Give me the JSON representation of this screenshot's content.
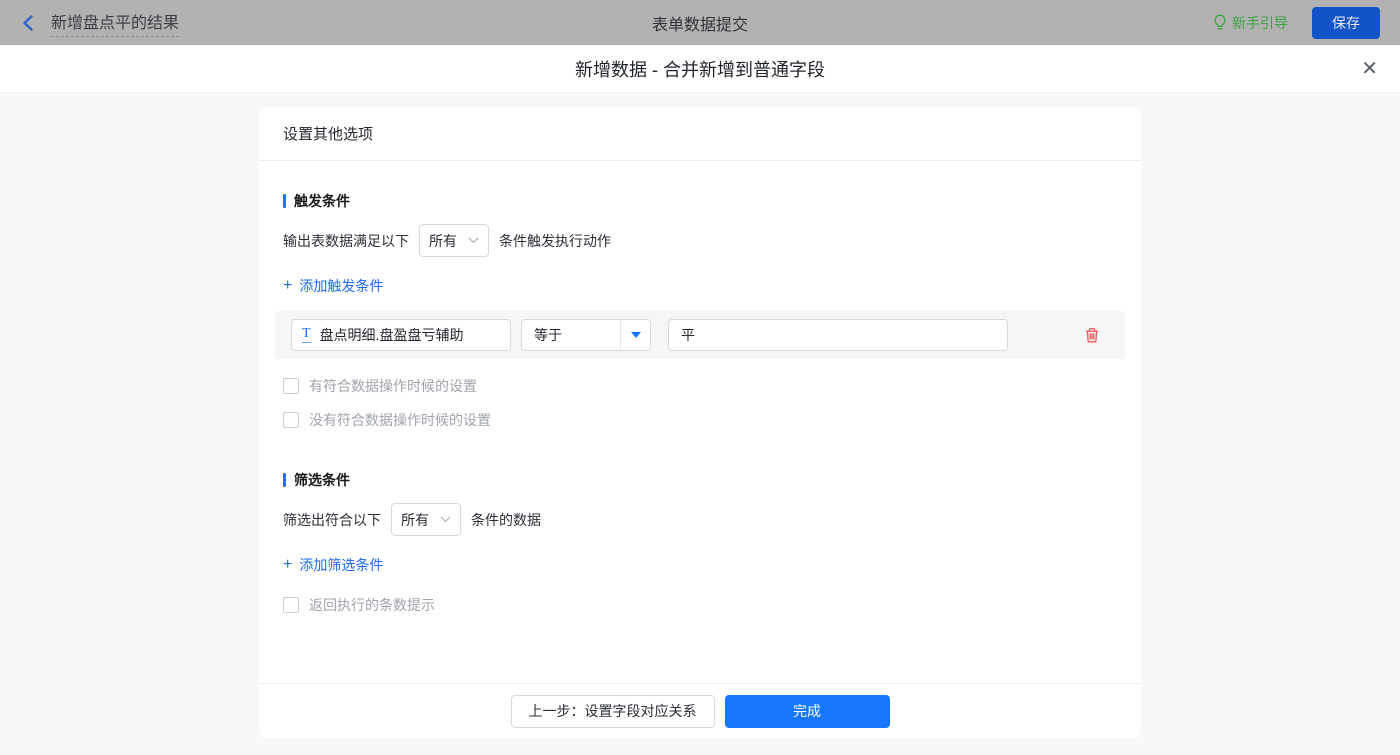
{
  "topbar": {
    "back_title": "新增盘点平的结果",
    "center_title": "表单数据提交",
    "guide_label": "新手引导",
    "save_label": "保存"
  },
  "modal": {
    "title": "新增数据 - 合并新增到普通字段",
    "close_glyph": "✕"
  },
  "card": {
    "header": "设置其他选项",
    "trigger_section": {
      "title": "触发条件",
      "prefix": "输出表数据满足以下",
      "select_value": "所有",
      "suffix": "条件触发执行动作",
      "add_plus": "+",
      "add_label": "添加触发条件",
      "condition": {
        "field_type_glyph": "T",
        "field": "盘点明细.盘盈盘亏辅助",
        "operator": "等于",
        "value": "平"
      },
      "checkboxes": {
        "0": "有符合数据操作时候的设置",
        "1": "没有符合数据操作时候的设置"
      }
    },
    "filter_section": {
      "title": "筛选条件",
      "prefix": "筛选出符合以下",
      "select_value": "所有",
      "suffix": "条件的数据",
      "add_plus": "+",
      "add_label": "添加筛选条件",
      "checkbox": "返回执行的条数提示"
    },
    "footer": {
      "prev_label": "上一步：设置字段对应关系",
      "done_label": "完成"
    }
  },
  "colors": {
    "accent_blue": "#1677ff",
    "link_blue": "#1c6bff",
    "save_button_blue": "#1254c8",
    "guide_green": "#3fa244",
    "danger_red": "#f0474a",
    "topbar_dim_gray": "#b2b2b2",
    "page_bg": "#f7f8fa",
    "row_bg": "#f5f6f7"
  }
}
